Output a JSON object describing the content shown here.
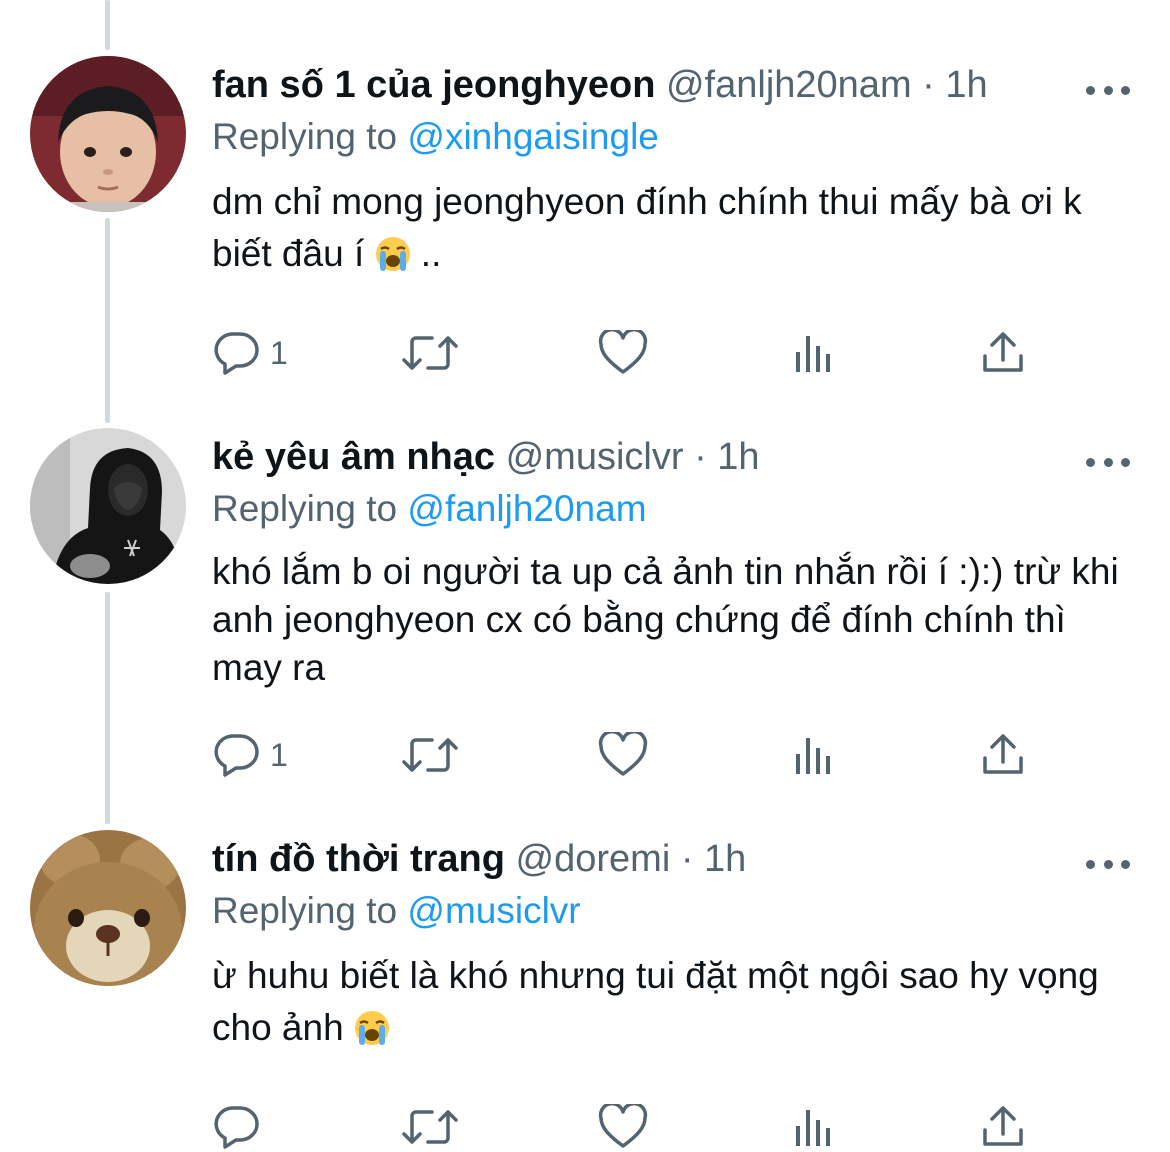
{
  "colors": {
    "text": "#0f1419",
    "secondary": "#536471",
    "link": "#1d9bf0",
    "thread_line": "#cfd9de"
  },
  "replying_prefix": "Replying to",
  "tweets": [
    {
      "display_name": "fan số 1 của jeonghyeon",
      "handle": "@fanljh20nam",
      "separator": "·",
      "time": "1h",
      "replying_to": "@xinhgaisingle",
      "text_before_emoji": "dm chỉ mong jeonghyeon đính chính thui mấy bà ơi k biết đâu í",
      "emoji": "loudly-crying-face",
      "text_after_emoji": "..",
      "reply_count": "1",
      "avatar": "child-photo"
    },
    {
      "display_name": "kẻ yêu âm nhạc",
      "handle": "@musiclvr",
      "separator": "·",
      "time": "1h",
      "replying_to": "@fanljh20nam",
      "text_before_emoji": "khó lắm b oi người ta up cả ảnh tin nhắn rồi í :):) trừ khi anh jeonghyeon cx có bằng chứng để đính chính thì may ra",
      "emoji": "",
      "text_after_emoji": "",
      "reply_count": "1",
      "avatar": "hooded-figure-photo"
    },
    {
      "display_name": "tín đồ thời trang",
      "handle": "@doremi",
      "separator": "·",
      "time": "1h",
      "replying_to": "@musiclvr",
      "text_before_emoji": "ừ huhu biết là khó nhưng tui đặt một ngôi sao hy vọng cho ảnh",
      "emoji": "loudly-crying-face",
      "text_after_emoji": "",
      "reply_count": "",
      "avatar": "teddy-bear-photo"
    }
  ]
}
